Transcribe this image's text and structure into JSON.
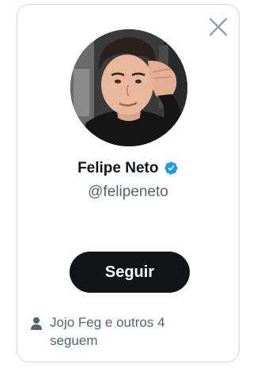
{
  "profile": {
    "display_name": "Felipe Neto",
    "handle": "@felipeneto",
    "verified": true
  },
  "actions": {
    "follow_label": "Seguir"
  },
  "social_context": {
    "text": "Jojo Feg e outros 4 seguem"
  },
  "icons": {
    "close": "close-icon",
    "verified": "verified-badge-icon",
    "person": "person-icon"
  },
  "colors": {
    "text_primary": "#0f1419",
    "text_secondary": "#536471",
    "verified_blue": "#1d9bf0",
    "close_icon": "#8fa3b0",
    "border": "#cfd9de",
    "button_bg": "#0f1419",
    "button_text": "#ffffff"
  }
}
